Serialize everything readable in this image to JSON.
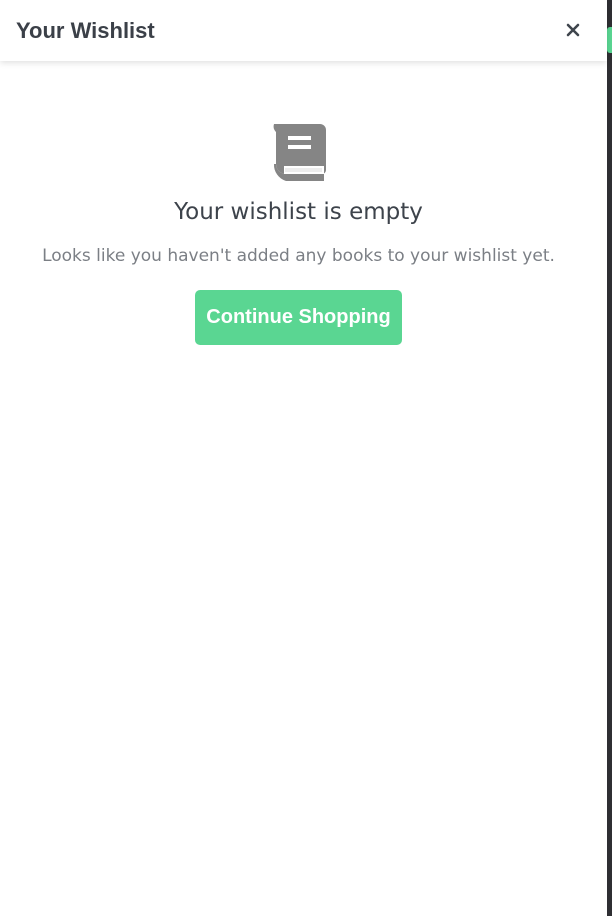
{
  "header": {
    "title": "Your Wishlist",
    "close_glyph": "×",
    "close_icon": "close-icon"
  },
  "empty_state": {
    "icon": "book-icon",
    "title": "Your wishlist is empty",
    "message": "Looks like you haven't added any books to your wishlist yet.",
    "button_label": "Continue Shopping"
  },
  "colors": {
    "accent": "#5ad692",
    "heading": "#3d434b",
    "muted_text": "#7b7f85",
    "icon": "#858585"
  }
}
